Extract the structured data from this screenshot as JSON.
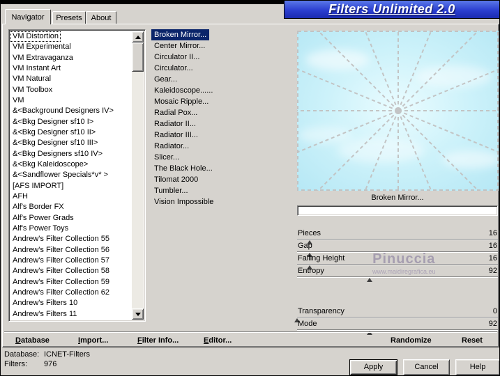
{
  "window": {
    "title": "Filters Unlimited 2.0"
  },
  "tabs": [
    {
      "label": "Navigator",
      "active": true
    },
    {
      "label": "Presets",
      "active": false
    },
    {
      "label": "About",
      "active": false
    }
  ],
  "navigator": {
    "selected_category": "VM Distortion",
    "selected_filter": "Broken Mirror...",
    "categories": [
      "VM Distortion",
      "VM Experimental",
      "VM Extravaganza",
      "VM Instant Art",
      "VM Natural",
      "VM Toolbox",
      "VM",
      "&<Background Designers IV>",
      "&<Bkg Designer sf10 I>",
      "&<Bkg Designer sf10 II>",
      "&<Bkg Designer sf10 III>",
      "&<Bkg Designers sf10 IV>",
      "&<Bkg Kaleidoscope>",
      "&<Sandflower Specials*v* >",
      "[AFS IMPORT]",
      "AFH",
      "Alf's Border FX",
      "Alf's Power Grads",
      "Alf's Power Toys",
      "Andrew's Filter Collection 55",
      "Andrew's Filter Collection 56",
      "Andrew's Filter Collection 57",
      "Andrew's Filter Collection 58",
      "Andrew's Filter Collection 59",
      "Andrew's Filter Collection 62",
      "Andrew's Filters 10",
      "Andrew's Filters 11"
    ],
    "filters": [
      "Broken Mirror...",
      "Center Mirror...",
      "Circulator II...",
      "Circulator...",
      "Gear...",
      "Kaleidoscope......",
      "Mosaic Ripple...",
      "Radial Pox...",
      "Radiator II...",
      "Radiator III...",
      "Radiator...",
      "Slicer...",
      "The Black Hole...",
      "Tilomat 2000",
      "Tumbler...",
      "Vision Impossible"
    ]
  },
  "preview": {
    "caption": "Broken Mirror..."
  },
  "parameters": {
    "group1": [
      {
        "label": "Pieces",
        "value": 16
      },
      {
        "label": "Gap",
        "value": 16
      },
      {
        "label": "Falling Height",
        "value": 16
      },
      {
        "label": "Entropy",
        "value": 92
      }
    ],
    "group2": [
      {
        "label": "Transparency",
        "value": 0
      },
      {
        "label": "Mode",
        "value": 92
      }
    ]
  },
  "watermark": {
    "name": "Pinuccia",
    "url": "www.maidiregrafica.eu"
  },
  "toolbar": {
    "database": "Database",
    "import_": "Import...",
    "filter_info": "Filter Info...",
    "editor": "Editor...",
    "randomize": "Randomize",
    "reset": "Reset"
  },
  "status": {
    "database_label": "Database:",
    "database_value": "ICNET-Filters",
    "filters_label": "Filters:",
    "filters_value": "976"
  },
  "buttons": {
    "apply": "Apply",
    "cancel": "Cancel",
    "help": "Help"
  },
  "colors": {
    "banner_blue": "#2b3fd0",
    "selection_blue": "#0a246a",
    "dialog_gray": "#d6d3ce",
    "preview_sky": "#cdeef7"
  }
}
